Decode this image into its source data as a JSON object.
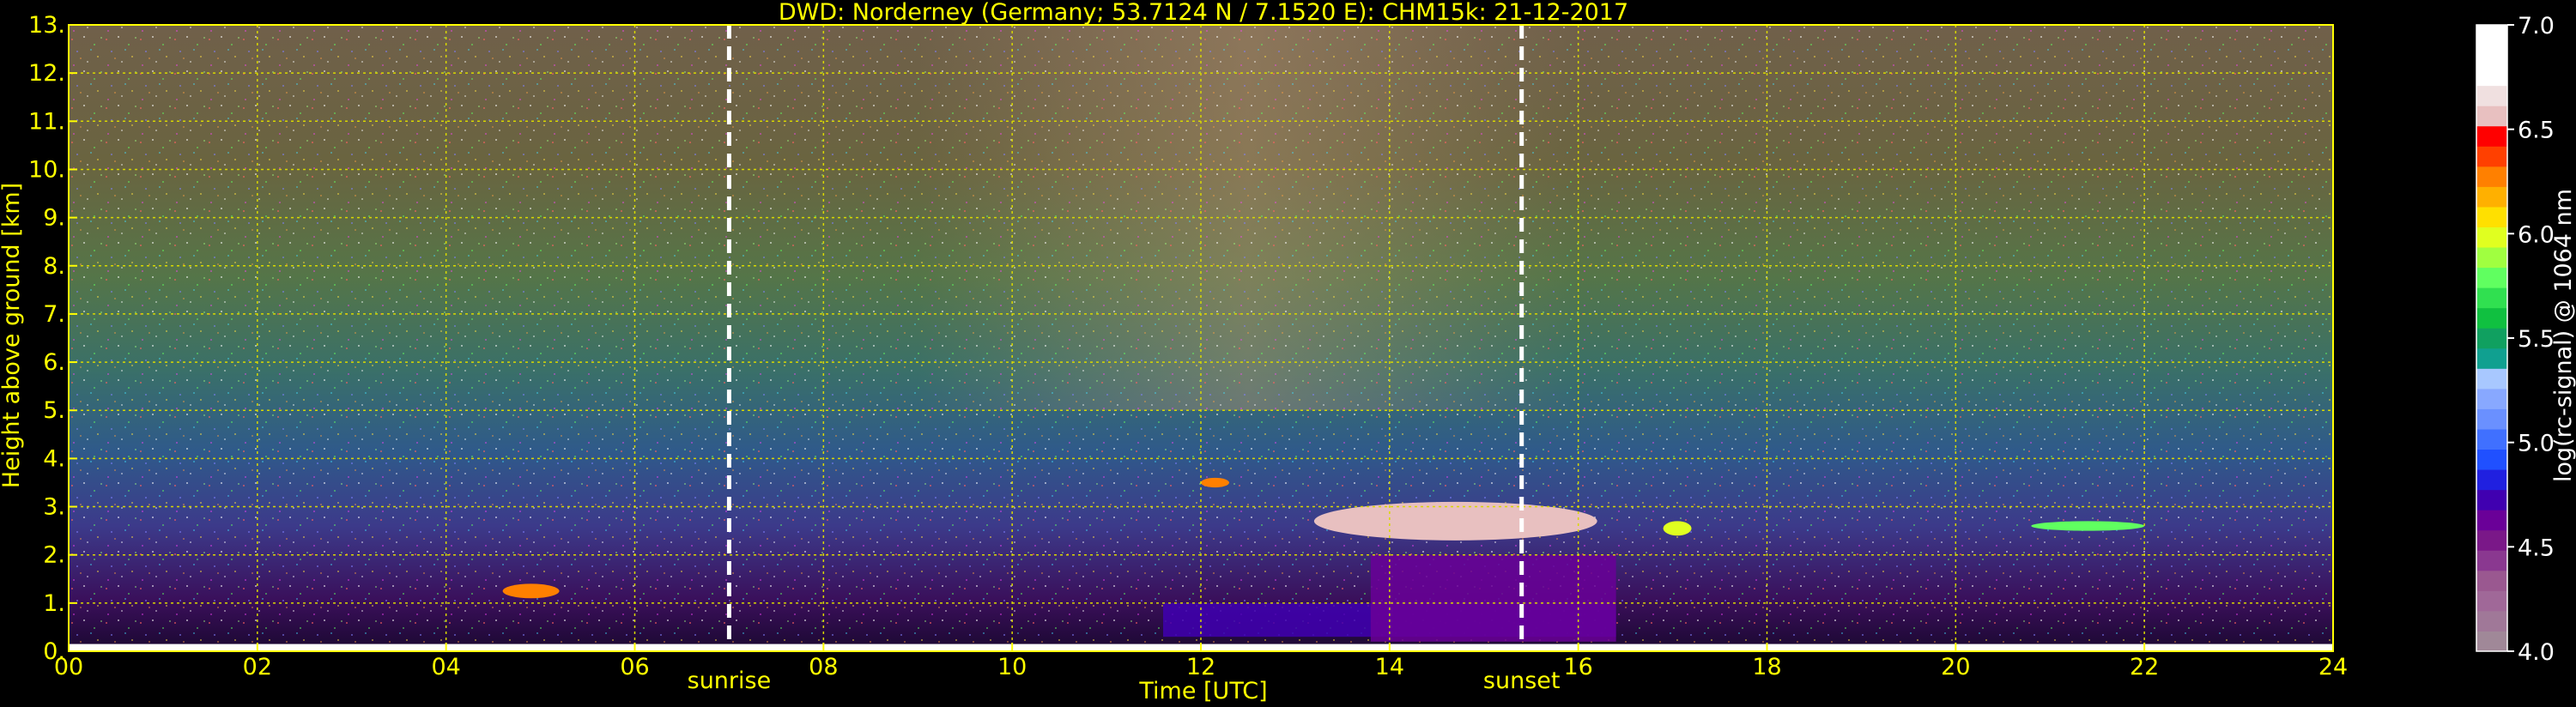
{
  "chart_data": {
    "type": "heatmap",
    "title": "DWD: Norderney (Germany; 53.7124 N / 7.1520 E):    CHM15k: 21-12-2017",
    "xlabel": "Time [UTC]",
    "ylabel": "Height above ground [km]",
    "x_ticks": [
      "00",
      "02",
      "04",
      "06",
      "08",
      "10",
      "12",
      "14",
      "16",
      "18",
      "20",
      "22",
      "24"
    ],
    "y_ticks": [
      "0.",
      "1.",
      "2.",
      "3.",
      "4.",
      "5.",
      "6.",
      "7.",
      "8.",
      "9.",
      "10.",
      "11.",
      "12.",
      "13."
    ],
    "xlim": [
      0,
      24
    ],
    "ylim": [
      0,
      13
    ],
    "grid": true,
    "annotations": [
      {
        "x": 7.0,
        "label": "sunrise"
      },
      {
        "x": 15.4,
        "label": "sunset"
      }
    ],
    "colorbar": {
      "label": "log(rc-signal) @ 1064 nm",
      "min": 4.0,
      "max": 7.0,
      "ticks": [
        "4.0",
        "4.5",
        "5.0",
        "5.5",
        "6.0",
        "6.5",
        "7.0"
      ],
      "tick_values": [
        4.0,
        4.5,
        5.0,
        5.5,
        6.0,
        6.5,
        7.0
      ],
      "colors": [
        "#a08898",
        "#a07898",
        "#a06898",
        "#9a5890",
        "#8a3890",
        "#7a1888",
        "#6a0098",
        "#4000b0",
        "#2020e0",
        "#2050ff",
        "#4070ff",
        "#6a90ff",
        "#88a8ff",
        "#a8c8ff",
        "#10a090",
        "#10a060",
        "#10c040",
        "#30e050",
        "#60ff60",
        "#a0ff40",
        "#e0ff20",
        "#ffe000",
        "#ffb000",
        "#ff8000",
        "#ff4000",
        "#ff0000",
        "#e8c0c0",
        "#f0e0e0",
        "#ffffff",
        "#ffffff",
        "#ffffff"
      ]
    },
    "cloud_layers": [
      {
        "t0": 4.6,
        "t1": 5.2,
        "h0": 1.1,
        "h1": 1.4,
        "value": 6.3
      },
      {
        "t0": 12.0,
        "t1": 12.3,
        "h0": 3.4,
        "h1": 3.6,
        "value": 6.3
      },
      {
        "t0": 13.2,
        "t1": 16.2,
        "h0": 2.3,
        "h1": 3.1,
        "value": 6.6
      },
      {
        "t0": 16.9,
        "t1": 17.2,
        "h0": 2.4,
        "h1": 2.7,
        "value": 6.0
      },
      {
        "t0": 20.8,
        "t1": 22.0,
        "h0": 2.5,
        "h1": 2.7,
        "value": 5.8
      }
    ],
    "boundary_layers": [
      {
        "t0": 11.6,
        "t1": 16.4,
        "h0": 0.3,
        "h1": 1.0,
        "value": 4.7
      },
      {
        "t0": 13.8,
        "t1": 16.4,
        "h0": 0.2,
        "h1": 2.0,
        "value": 4.6
      }
    ],
    "surface_layer": {
      "h0": 0.0,
      "h1": 0.15,
      "value": 7.0
    }
  }
}
